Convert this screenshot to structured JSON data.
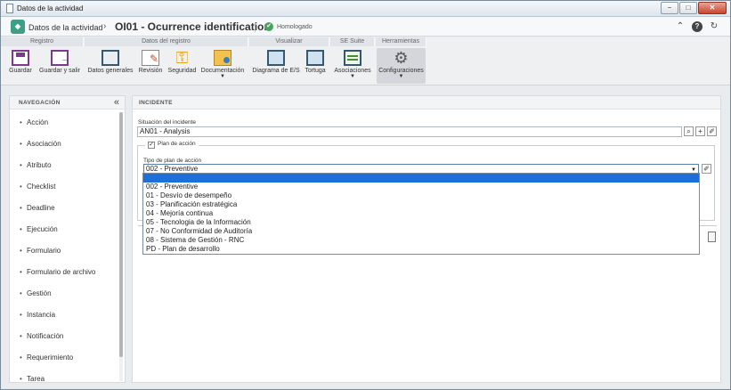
{
  "window": {
    "title": "Datos de la actividad",
    "controls": [
      "−",
      "□",
      "✕"
    ]
  },
  "header": {
    "app_name": "Datos de la actividad",
    "separator": "›",
    "record_title": "OI01 - Ocurrence identification",
    "status": "Homologado",
    "status_color": "#46a55a",
    "right_icons": [
      "collapse-up-icon",
      "help-icon",
      "refresh-icon"
    ]
  },
  "ribbon": {
    "groups": [
      "Registro",
      "Datos del registro",
      "Visualizar",
      "SE Suite",
      "Herramientas"
    ],
    "buttons": [
      {
        "label": "Guardar",
        "icon": "save-icon"
      },
      {
        "label": "Guardar y salir",
        "icon": "save-exit-icon"
      },
      {
        "label": "Datos generales",
        "icon": "general-data-icon"
      },
      {
        "label": "Revisión",
        "icon": "review-icon"
      },
      {
        "label": "Seguridad",
        "icon": "key-icon"
      },
      {
        "label": "Documentación",
        "icon": "documentation-icon"
      },
      {
        "label": "Diagrama de E/S",
        "icon": "diagram-icon"
      },
      {
        "label": "Tortuga",
        "icon": "turtle-icon"
      },
      {
        "label": "Asociaciones",
        "icon": "associations-icon"
      },
      {
        "label": "Configuraciones",
        "icon": "gears-icon"
      }
    ]
  },
  "sidebar": {
    "title": "NAVEGACIÓN",
    "collapse_glyph": "«",
    "items": [
      "Acción",
      "Asociación",
      "Atributo",
      "Checklist",
      "Deadline",
      "Ejecución",
      "Formulario",
      "Formulario de archivo",
      "Gestión",
      "Instancia",
      "Notificación",
      "Requerimiento",
      "Tarea"
    ]
  },
  "main": {
    "section_title": "INCIDENTE",
    "situation_label": "Situación del incidente",
    "situation_value": "AN01 - Analysis",
    "plan_checkbox_label": "Plan de acción",
    "plan_checked": true,
    "plan_type_label": "Tipo de plan de acción",
    "plan_type_value": "002 - Preventive",
    "dropdown_options": [
      "",
      "002 - Preventive",
      "01 - Desvío de desempeño",
      "03 - Planificación estratégica",
      "04 - Mejoría continua",
      "05 - Tecnologia de la Información",
      "07 - No Conformidad de Auditoría",
      "08 - Sistema de Gestión - RNC",
      "PD - Plan de desarrollo"
    ],
    "highlight_color": "#1e6fd9"
  }
}
